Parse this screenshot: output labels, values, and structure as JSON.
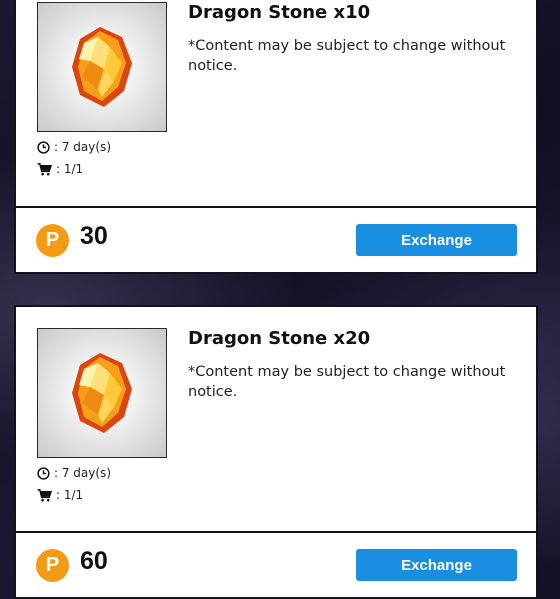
{
  "items": [
    {
      "title": "Dragon Stone x10",
      "description": "*Content may be subject to change without notice.",
      "duration": ": 7 day(s)",
      "limit": ": 1/1",
      "price": "30",
      "currency_symbol": "P",
      "button_label": "Exchange",
      "icon": "dragon-stone-gem"
    },
    {
      "title": "Dragon Stone x20",
      "description": "*Content may be subject to change without notice.",
      "duration": ": 7 day(s)",
      "limit": ": 1/1",
      "price": "60",
      "currency_symbol": "P",
      "button_label": "Exchange",
      "icon": "dragon-stone-gem"
    }
  ],
  "colors": {
    "accent_button": "#1a8ee0",
    "currency_coin": "#f29b16",
    "card_border": "#14121f"
  }
}
